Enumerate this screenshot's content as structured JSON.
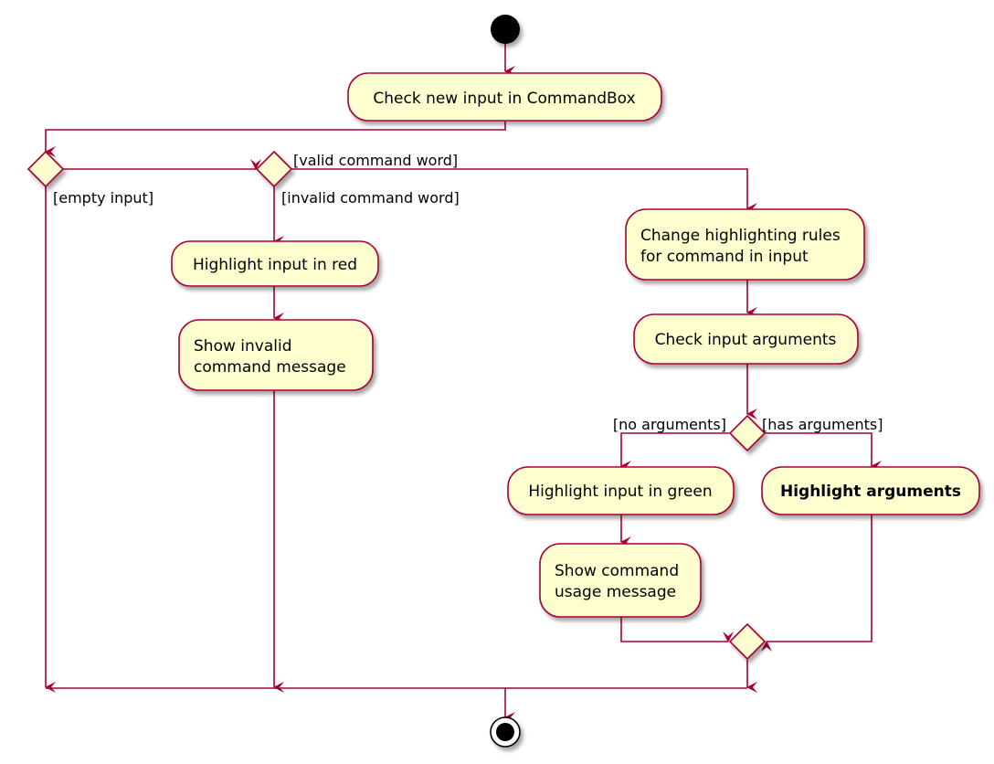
{
  "diagram": {
    "type": "activity",
    "colors": {
      "line": "#A80036",
      "node_fill": "#FEFECE",
      "start_fill": "#000000"
    },
    "actions": {
      "check_input": "Check new input in CommandBox",
      "highlight_red": "Highlight input in red",
      "show_invalid_l1": "Show invalid",
      "show_invalid_l2": "command message",
      "change_rules_l1": "Change highlighting rules",
      "change_rules_l2": "for command in input",
      "check_args": "Check input arguments",
      "highlight_green": "Highlight input in green",
      "highlight_args": "Highlight arguments",
      "show_usage_l1": "Show command",
      "show_usage_l2": "usage message"
    },
    "guards": {
      "empty_input": "[empty input]",
      "valid_command": "[valid command word]",
      "invalid_command": "[invalid command word]",
      "no_arguments": "[no arguments]",
      "has_arguments": "[has arguments]"
    }
  }
}
